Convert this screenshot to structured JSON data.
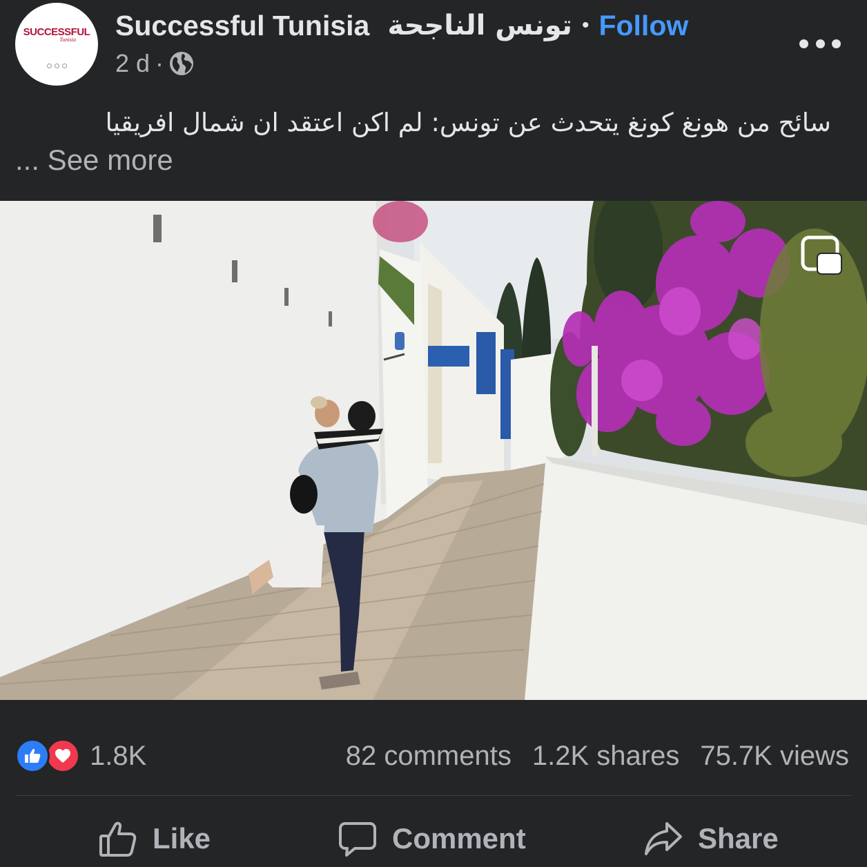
{
  "page": {
    "name": "Successful Tunisia",
    "name_ar": "تونس الناجحة",
    "separator": "•",
    "follow_label": "Follow",
    "avatar_logo": "SUCCESSFUL",
    "avatar_logo_sub": "Tunisia",
    "accent_color": "#4599ff"
  },
  "meta": {
    "time": "2 d",
    "separator": "·",
    "audience_icon": "globe-icon"
  },
  "post": {
    "caption": "سائح من هونغ كونغ يتحدث عن تونس: لم اكن اعتقد ان شمال افريقيا",
    "see_more_label": "... See more",
    "media_icon": "picture-in-picture-icon"
  },
  "stats": {
    "reaction_icons": [
      "like-icon",
      "love-icon"
    ],
    "reactions": "1.8K",
    "comments": "82 comments",
    "shares": "1.2K shares",
    "views": "75.7K views"
  },
  "actions": {
    "like": "Like",
    "comment": "Comment",
    "share": "Share"
  }
}
